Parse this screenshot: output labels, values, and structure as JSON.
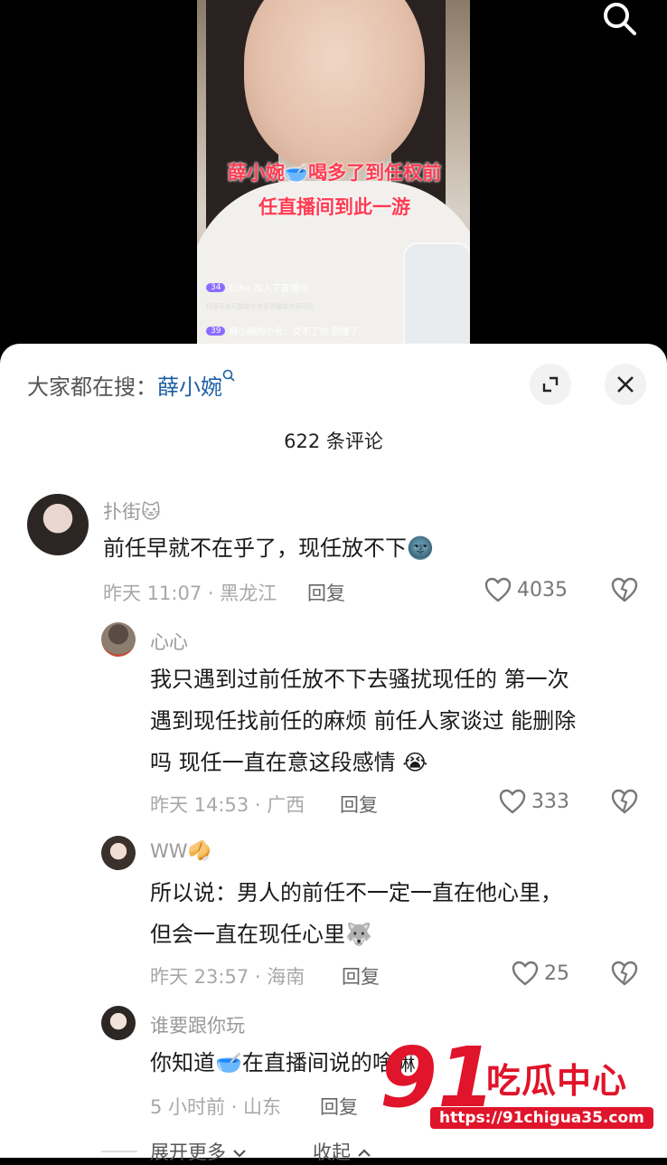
{
  "video": {
    "caption_line1": "薛小婉🥣喝多了到任权前",
    "caption_line2": "任直播间到此一游",
    "live_messages": [
      {
        "badge": "34",
        "text": "Echo 加入了直播间"
      },
      {
        "badge": "",
        "text": "抖音平台可能存在信息泄露或交易风险"
      },
      {
        "badge": "39",
        "text": "薛小婉的小号：交不了你 别蹭了"
      }
    ]
  },
  "sheet": {
    "search_label": "大家都在搜：",
    "search_keyword": "薛小婉",
    "comment_count": "622 条评论"
  },
  "comments": [
    {
      "name": "扑街🐱",
      "text_lines": [
        "前任早就不在乎了，现任放不下🌚"
      ],
      "meta": "昨天 11:07 · 黑龙江",
      "reply": "回复",
      "likes": "4035"
    },
    {
      "name": "心心",
      "text_lines": [
        "我只遇到过前任放不下去骚扰现任的 第一次",
        "遇到现任找前任的麻烦 前任人家谈过 能删除",
        "吗 现任一直在意这段感情 😭"
      ],
      "meta": "昨天 14:53 · 广西",
      "reply": "回复",
      "likes": "333"
    },
    {
      "name": "WW🥠",
      "text_lines": [
        "所以说：男人的前任不一定一直在他心里，",
        "但会一直在现任心里🐺"
      ],
      "meta": "昨天 23:57 · 海南",
      "reply": "回复",
      "likes": "25"
    },
    {
      "name": "谁要跟你玩",
      "text_lines": [
        "你知道🥣在直播间说的啥嘛"
      ],
      "meta": "5 小时前 · 山东",
      "reply": "回复",
      "likes": ""
    }
  ],
  "footer": {
    "expand": "展开更多",
    "collapse": "收起"
  },
  "watermark": {
    "big": "91",
    "cn": "吃瓜中心",
    "url": "https://91chigua35.com"
  }
}
